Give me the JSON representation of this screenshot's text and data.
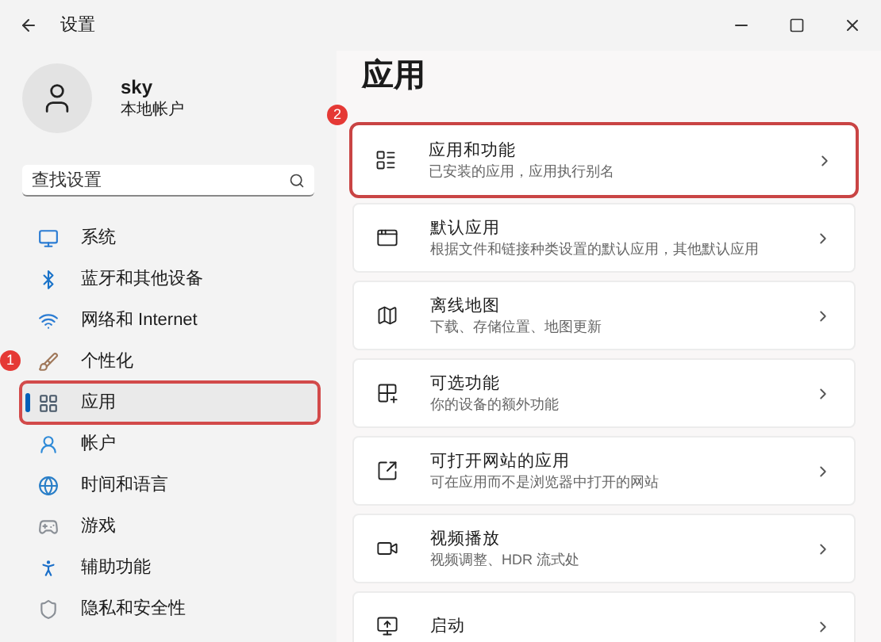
{
  "window": {
    "title": "设置"
  },
  "user": {
    "name": "sky",
    "account": "本地帐户"
  },
  "search": {
    "placeholder": "查找设置"
  },
  "nav": [
    {
      "kind": "system",
      "label": "系统",
      "selected": false
    },
    {
      "kind": "bluetooth",
      "label": "蓝牙和其他设备",
      "selected": false
    },
    {
      "kind": "network",
      "label": "网络和 Internet",
      "selected": false
    },
    {
      "kind": "personalize",
      "label": "个性化",
      "selected": false,
      "callout": "1"
    },
    {
      "kind": "apps",
      "label": "应用",
      "selected": true,
      "highlighted": true
    },
    {
      "kind": "accounts",
      "label": "帐户",
      "selected": false
    },
    {
      "kind": "time",
      "label": "时间和语言",
      "selected": false
    },
    {
      "kind": "gaming",
      "label": "游戏",
      "selected": false
    },
    {
      "kind": "accessibility",
      "label": "辅助功能",
      "selected": false
    },
    {
      "kind": "privacy",
      "label": "隐私和安全性",
      "selected": false
    }
  ],
  "page": {
    "title": "应用"
  },
  "cards": [
    {
      "kind": "features",
      "title": "应用和功能",
      "subtitle": "已安装的应用，应用执行别名",
      "highlighted": true,
      "callout": "2"
    },
    {
      "kind": "default",
      "title": "默认应用",
      "subtitle": "根据文件和链接种类设置的默认应用，其他默认应用"
    },
    {
      "kind": "maps",
      "title": "离线地图",
      "subtitle": "下载、存储位置、地图更新"
    },
    {
      "kind": "optional",
      "title": "可选功能",
      "subtitle": "你的设备的额外功能"
    },
    {
      "kind": "websites",
      "title": "可打开网站的应用",
      "subtitle": "可在应用而不是浏览器中打开的网站"
    },
    {
      "kind": "video",
      "title": "视频播放",
      "subtitle": "视频调整、HDR 流式处"
    },
    {
      "kind": "startup",
      "title": "启动"
    }
  ]
}
